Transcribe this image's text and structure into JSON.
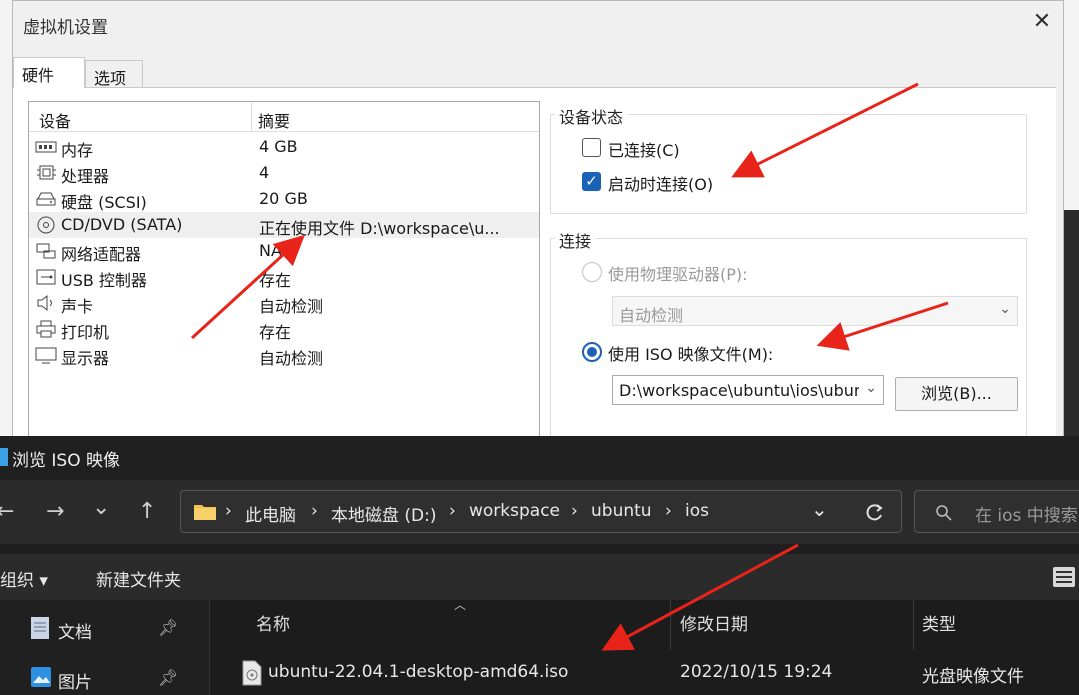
{
  "vm_dialog": {
    "title": "虚拟机设置",
    "close_glyph": "✕",
    "tabs": [
      {
        "label": "硬件"
      },
      {
        "label": "选项"
      }
    ],
    "device_header": {
      "device": "设备",
      "summary": "摘要"
    },
    "devices": [
      {
        "name": "内存",
        "summary": "4 GB",
        "icon": "memory-icon"
      },
      {
        "name": "处理器",
        "summary": "4",
        "icon": "cpu-icon"
      },
      {
        "name": "硬盘 (SCSI)",
        "summary": "20 GB",
        "icon": "hard-disk-icon"
      },
      {
        "name": "CD/DVD (SATA)",
        "summary": "正在使用文件 D:\\workspace\\u...",
        "icon": "cd-dvd-icon",
        "selected": true
      },
      {
        "name": "网络适配器",
        "summary": "NAT",
        "icon": "network-adapter-icon"
      },
      {
        "name": "USB 控制器",
        "summary": "存在",
        "icon": "usb-icon"
      },
      {
        "name": "声卡",
        "summary": "自动检测",
        "icon": "sound-icon"
      },
      {
        "name": "打印机",
        "summary": "存在",
        "icon": "printer-icon"
      },
      {
        "name": "显示器",
        "summary": "自动检测",
        "icon": "display-icon"
      }
    ],
    "device_status": {
      "label": "设备状态",
      "connected": {
        "label": "已连接(C)",
        "checked": false
      },
      "connect_on_power_on": {
        "label": "启动时连接(O)",
        "checked": true
      }
    },
    "connection": {
      "label": "连接",
      "physical_drive": {
        "label": "使用物理驱动器(P):",
        "selected": false,
        "disabled": true,
        "value": "自动检测"
      },
      "iso_image": {
        "label": "使用 ISO 映像文件(M):",
        "selected": true,
        "value": "D:\\workspace\\ubuntu\\ios\\ubuntu"
      },
      "browse_label": "浏览(B)..."
    }
  },
  "file_browser": {
    "title": "浏览 ISO 映像",
    "nav": {
      "back": "←",
      "forward": "→",
      "recent": "⌄",
      "up": "↑"
    },
    "breadcrumb": [
      "此电脑",
      "本地磁盘 (D:)",
      "workspace",
      "ubuntu",
      "ios"
    ],
    "breadcrumb_sep": "›",
    "search_placeholder": "在 ios 中搜索",
    "toolbar": {
      "organize": "组织 ▾",
      "new_folder": "新建文件夹"
    },
    "sidebar": [
      {
        "label": "文档",
        "icon": "documents-icon"
      },
      {
        "label": "图片",
        "icon": "pictures-icon"
      }
    ],
    "columns": {
      "name": "名称",
      "modified": "修改日期",
      "type": "类型"
    },
    "files": [
      {
        "name": "ubuntu-22.04.1-desktop-amd64.iso",
        "modified": "2022/10/15 19:24",
        "type": "光盘映像文件"
      }
    ]
  },
  "colors": {
    "accent": "#1a62b8",
    "arrow": "#e8241a"
  }
}
